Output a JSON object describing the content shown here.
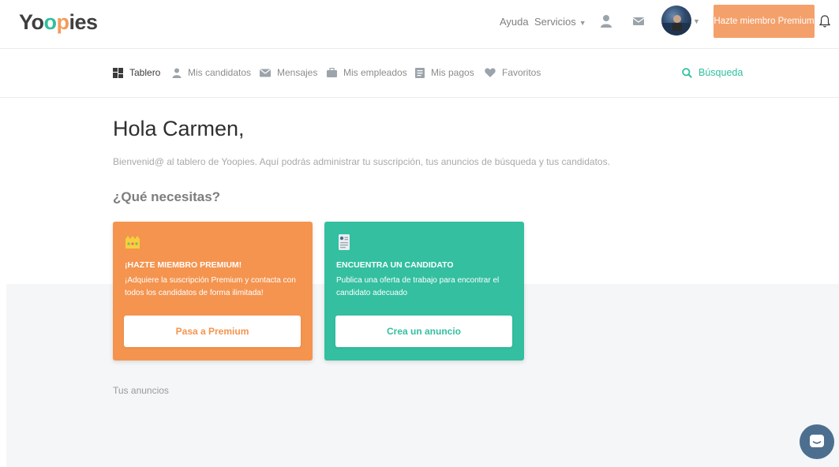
{
  "brand": {
    "logo_parts": [
      "Yo",
      "o",
      "p",
      "ies"
    ],
    "accent": "#2fbf9f",
    "orange": "#f4944f"
  },
  "topbar": {
    "help": "Ayuda",
    "services": "Servicios",
    "premium_button": "Hazte miembro Premium"
  },
  "subnav": {
    "items": [
      {
        "label": "Tablero",
        "icon": "dashboard-icon"
      },
      {
        "label": "Mis candidatos",
        "icon": "user-icon"
      },
      {
        "label": "Mensajes",
        "icon": "envelope-icon"
      },
      {
        "label": "Mis empleados",
        "icon": "briefcase-icon"
      },
      {
        "label": "Mis pagos",
        "icon": "receipt-icon"
      },
      {
        "label": "Favoritos",
        "icon": "heart-icon"
      }
    ],
    "search": "Búsqueda"
  },
  "main": {
    "greeting": "Hola Carmen,",
    "welcome": "Bienvenid@ al tablero de Yoopies. Aquí podrás administrar tu suscripción, tus anuncios de búsqueda y tus candidatos.",
    "question": "¿Qué necesitas?",
    "cards": [
      {
        "icon": "crown-icon",
        "title": "¡HAZTE MIEMBRO PREMIUM!",
        "text": "¡Adquiere la suscripción Premium y contacta con todos los candidatos de forma ilimitada!",
        "button": "Pasa a Premium"
      },
      {
        "icon": "candidate-card-icon",
        "title": "ENCUENTRA UN CANDIDATO",
        "text": "Publica una oferta de trabajo para encontrar el candidato adecuado",
        "button": "Crea un anuncio"
      }
    ],
    "ads_label": "Tus anuncios"
  }
}
